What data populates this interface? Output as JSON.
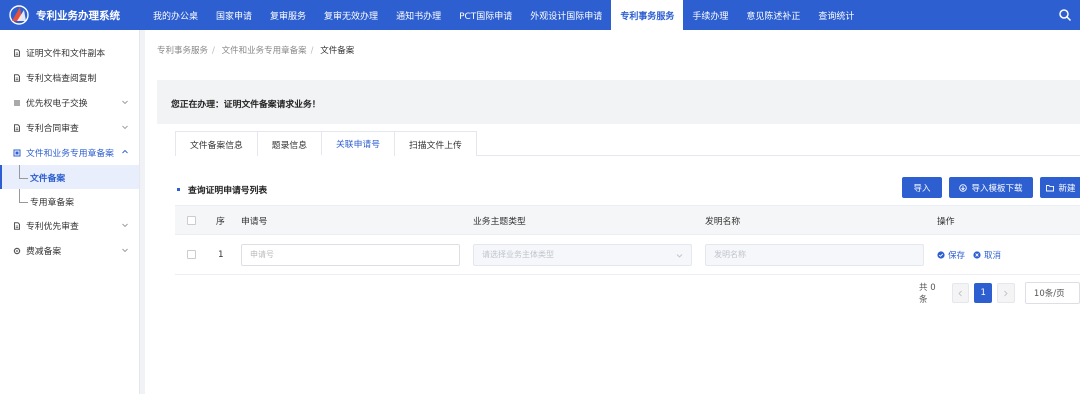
{
  "app": {
    "title": "专利业务办理系统"
  },
  "topnav": [
    {
      "label": "我的办公桌"
    },
    {
      "label": "国家申请"
    },
    {
      "label": "复审服务"
    },
    {
      "label": "复审无效办理"
    },
    {
      "label": "通知书办理"
    },
    {
      "label": "PCT国际申请"
    },
    {
      "label": "外观设计国际申请"
    },
    {
      "label": "专利事务服务",
      "active": true
    },
    {
      "label": "手续办理"
    },
    {
      "label": "意见陈述补正"
    },
    {
      "label": "查询统计"
    }
  ],
  "sidebar": {
    "items": [
      {
        "label": "证明文件和文件副本",
        "icon": "doc-icon"
      },
      {
        "label": "专利文档查阅复制",
        "icon": "doc-icon"
      },
      {
        "label": "优先权电子交换",
        "icon": "list-icon",
        "chevron": "down"
      },
      {
        "label": "专利合同审查",
        "icon": "doc-icon",
        "chevron": "down"
      },
      {
        "label": "文件和业务专用章备案",
        "icon": "seal-icon",
        "chevron": "up",
        "open": true
      },
      {
        "label": "专利优先审查",
        "icon": "doc-icon",
        "chevron": "down"
      },
      {
        "label": "费减备案",
        "icon": "gear-icon",
        "chevron": "down"
      }
    ],
    "subitems": [
      {
        "label": "文件备案",
        "active": true
      },
      {
        "label": "专用章备案"
      }
    ]
  },
  "breadcrumb": [
    "专利事务服务",
    "文件和业务专用章备案",
    "文件备案"
  ],
  "notice": "您正在办理：证明文件备案请求业务！",
  "tabs": [
    {
      "label": "文件备案信息"
    },
    {
      "label": "题录信息"
    },
    {
      "label": "关联申请号",
      "active": true
    },
    {
      "label": "扫描文件上传"
    }
  ],
  "section": {
    "title": "查询证明申请号列表"
  },
  "buttons": {
    "import": "导入",
    "template": "导入模板下载",
    "new": "新建"
  },
  "table": {
    "headers": [
      "序",
      "申请号",
      "业务主题类型",
      "发明名称",
      "操作"
    ],
    "rows": [
      {
        "index": "1",
        "app_no_placeholder": "申请号",
        "type_placeholder": "请选择业务主体类型",
        "name_placeholder": "发明名称",
        "ops": [
          "保存",
          "取消"
        ]
      }
    ]
  },
  "pagination": {
    "total": "共 0 条",
    "current": "1",
    "page_size": "10条/页"
  },
  "colors": {
    "primary": "#2d5fd0",
    "header_bg": "#2d5fd0"
  }
}
